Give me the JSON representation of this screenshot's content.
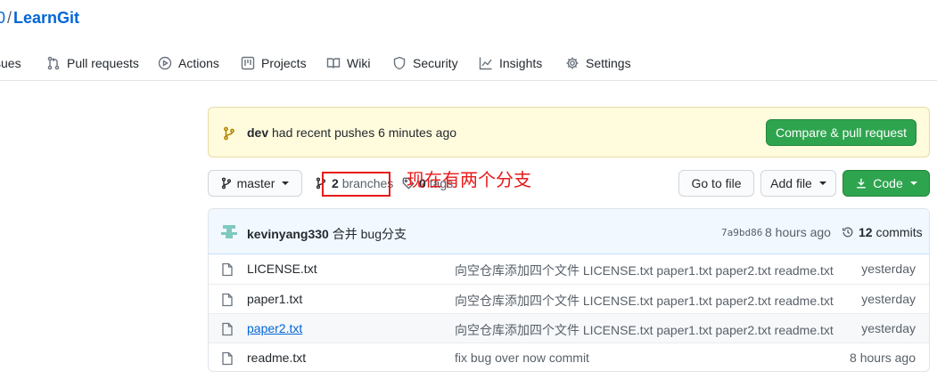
{
  "repo": {
    "owner_fragment": "0",
    "separator": "/",
    "name": "LearnGit"
  },
  "nav": {
    "issues": "sues",
    "pull_requests": "Pull requests",
    "actions": "Actions",
    "projects": "Projects",
    "wiki": "Wiki",
    "security": "Security",
    "insights": "Insights",
    "settings": "Settings"
  },
  "flash": {
    "branch": "dev",
    "message": " had recent pushes 6 minutes ago",
    "button": "Compare & pull request"
  },
  "toolbar": {
    "branch_selector": "master",
    "branches_count": "2",
    "branches_label": "branches",
    "tags_count": "0",
    "tags_label": "tags",
    "go_to_file": "Go to file",
    "add_file": "Add file",
    "code": "Code"
  },
  "annotation": {
    "text": "现在有两个分支",
    "color": "#e8191a"
  },
  "latest_commit": {
    "author": "kevinyang330",
    "message": " 合并 bug分支",
    "sha": "7a9bd86",
    "time": "8 hours ago",
    "commits_count": "12",
    "commits_label": "commits"
  },
  "files": [
    {
      "name": "LICENSE.txt",
      "message": "向空仓库添加四个文件 LICENSE.txt paper1.txt paper2.txt readme.txt",
      "age": "yesterday"
    },
    {
      "name": "paper1.txt",
      "message": "向空仓库添加四个文件 LICENSE.txt paper1.txt paper2.txt readme.txt",
      "age": "yesterday"
    },
    {
      "name": "paper2.txt",
      "message": "向空仓库添加四个文件 LICENSE.txt paper1.txt paper2.txt readme.txt",
      "age": "yesterday"
    },
    {
      "name": "readme.txt",
      "message": "fix bug over now commit",
      "age": "8 hours ago"
    }
  ],
  "colors": {
    "accent": "#0366d6",
    "green": "#2ea44f",
    "flash_bg": "#fffbdd",
    "annotation_red": "#e8191a"
  }
}
